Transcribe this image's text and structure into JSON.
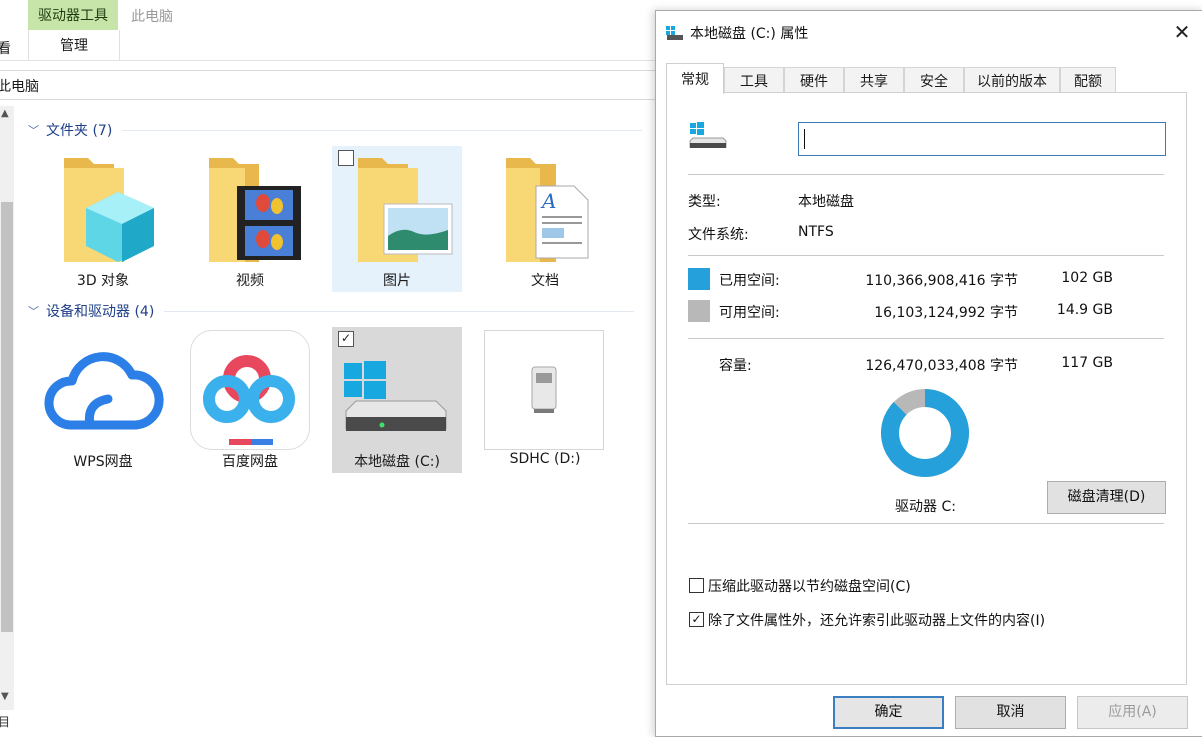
{
  "explorer": {
    "ribbon": {
      "tool_tab": "驱动器工具",
      "pc_tab": "此电脑",
      "manage": "管理",
      "cut_text": "看"
    },
    "address": "此电脑",
    "status": "目",
    "folders_header": "文件夹 (7)",
    "devices_header": "设备和驱动器 (4)",
    "folders": [
      {
        "label": "3D 对象",
        "icon": "folder-3d-icon"
      },
      {
        "label": "视频",
        "icon": "folder-video-icon"
      },
      {
        "label": "图片",
        "icon": "folder-pictures-icon"
      },
      {
        "label": "文档",
        "icon": "folder-documents-icon"
      }
    ],
    "devices": [
      {
        "label": "WPS网盘",
        "icon": "wps-cloud-icon"
      },
      {
        "label": "百度网盘",
        "icon": "baidu-netdisk-icon"
      },
      {
        "label": "本地磁盘 (C:)",
        "icon": "local-disk-icon"
      },
      {
        "label": "SDHC (D:)",
        "icon": "sd-card-icon"
      }
    ]
  },
  "dialog": {
    "title": "本地磁盘 (C:) 属性",
    "tabs": [
      "常规",
      "工具",
      "硬件",
      "共享",
      "安全",
      "以前的版本",
      "配额"
    ],
    "active_tab": "常规",
    "name_value": "",
    "type_label": "类型:",
    "type_value": "本地磁盘",
    "fs_label": "文件系统:",
    "fs_value": "NTFS",
    "used_label": "已用空间:",
    "used_bytes": "110,366,908,416 字节",
    "used_gb": "102 GB",
    "free_label": "可用空间:",
    "free_bytes": "16,103,124,992 字节",
    "free_gb": "14.9 GB",
    "cap_label": "容量:",
    "cap_bytes": "126,470,033,408 字节",
    "cap_gb": "117 GB",
    "drive_label": "驱动器 C:",
    "cleanup_button": "磁盘清理(D)",
    "compress_label": "压缩此驱动器以节约磁盘空间(C)",
    "compress_checked": false,
    "index_label": "除了文件属性外，还允许索引此驱动器上文件的内容(I)",
    "index_checked": true,
    "ok_button": "确定",
    "cancel_button": "取消",
    "apply_button": "应用(A)",
    "used_fraction": 0.8727,
    "colors": {
      "used": "#26a0da",
      "free": "#b8b8b8"
    }
  }
}
